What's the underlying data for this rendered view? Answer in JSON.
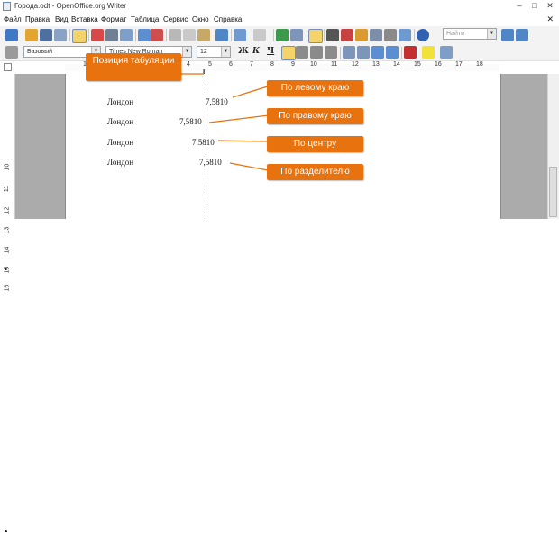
{
  "window": {
    "title": "Города.odt - OpenOffice.org Writer",
    "minimize": "–",
    "maximize": "□",
    "close": "✕"
  },
  "menubar": {
    "items": [
      "Файл",
      "Правка",
      "Вид",
      "Вставка",
      "Формат",
      "Таблица",
      "Сервис",
      "Окно",
      "Справка"
    ],
    "doc_close": "✕"
  },
  "toolbar": {
    "style_value": "Базовый",
    "font_value": "Times New Roman",
    "size_value": "12",
    "find_placeholder": "Найти",
    "bold": "Ж",
    "italic": "К",
    "underline": "Ч"
  },
  "ruler": {
    "labels": [
      "1",
      "2",
      "3",
      "4",
      "5",
      "6",
      "7",
      "8",
      "9",
      "10",
      "11",
      "12",
      "13",
      "14",
      "15",
      "16",
      "17",
      "18"
    ]
  },
  "vruler": {
    "labels": [
      "10",
      "11",
      "12",
      "13",
      "14",
      "15",
      "16"
    ]
  },
  "document": {
    "rows": [
      {
        "city": "Лондон",
        "value": "7,5810"
      },
      {
        "city": "Лондон",
        "value": "7,5810"
      },
      {
        "city": "Лондон",
        "value": "7,5810"
      },
      {
        "city": "Лондон",
        "value": "7,5810"
      }
    ]
  },
  "callouts": {
    "tab_position": "Позиция табуляции",
    "left": "По левому краю",
    "right": "По правому краю",
    "center": "По центру",
    "decimal": "По разделителю"
  },
  "colors": {
    "callout": "#e8720e",
    "editor_bg": "#ababab"
  }
}
